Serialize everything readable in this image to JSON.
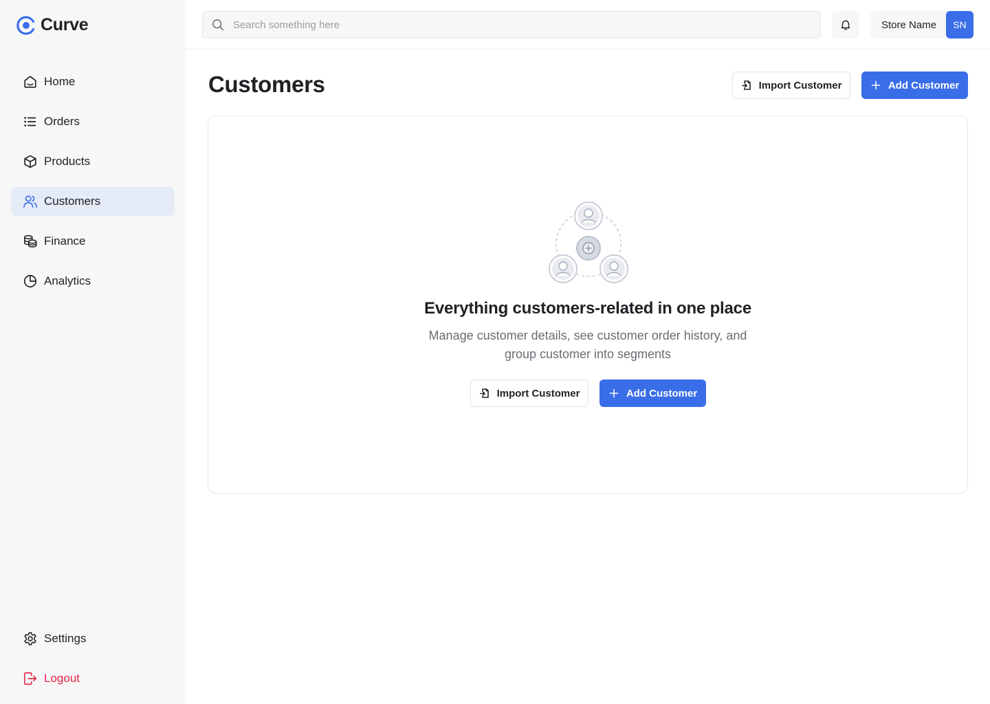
{
  "brand": {
    "name": "Curve",
    "color": "#3a6ee8"
  },
  "sidebar": {
    "items": [
      {
        "label": "Home",
        "icon": "home-icon",
        "active": false
      },
      {
        "label": "Orders",
        "icon": "list-icon",
        "active": false
      },
      {
        "label": "Products",
        "icon": "box-icon",
        "active": false
      },
      {
        "label": "Customers",
        "icon": "users-icon",
        "active": true
      },
      {
        "label": "Finance",
        "icon": "coins-icon",
        "active": false
      },
      {
        "label": "Analytics",
        "icon": "pie-chart-icon",
        "active": false
      }
    ],
    "bottom": [
      {
        "label": "Settings",
        "icon": "gear-icon"
      },
      {
        "label": "Logout",
        "icon": "logout-icon",
        "color": "#e5274b"
      }
    ]
  },
  "topbar": {
    "search_placeholder": "Search something here",
    "search_value": "",
    "store_name": "Store Name",
    "store_initials": "SN"
  },
  "header": {
    "title": "Customers",
    "import_label": "Import Customer",
    "add_label": "Add Customer"
  },
  "empty_state": {
    "title": "Everything customers-related in one place",
    "description": "Manage customer details, see customer order history, and group customer into segments",
    "import_label": "Import Customer",
    "add_label": "Add Customer"
  },
  "colors": {
    "accent": "#3a6ee8",
    "active_nav_bg": "#e4ebf7",
    "danger": "#e5274b",
    "sidebar_bg": "#f7f7f8"
  }
}
